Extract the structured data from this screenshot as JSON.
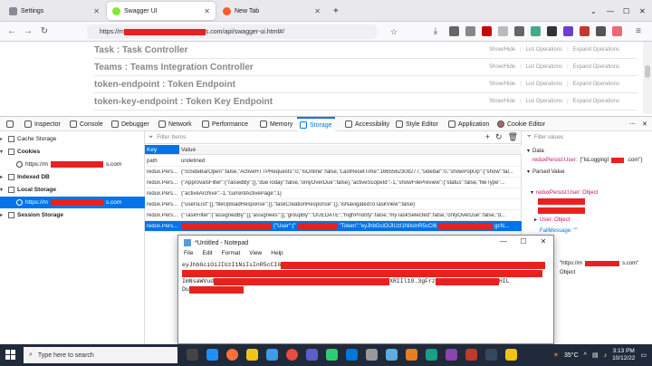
{
  "browser": {
    "tabs": [
      {
        "label": "Settings",
        "active": false
      },
      {
        "label": "Swagger UI",
        "active": true
      },
      {
        "label": "New Tab",
        "active": false
      }
    ],
    "url_prefix": "https://m",
    "url_suffix": "s.com/api/swagger-ui.html#/"
  },
  "swagger": {
    "rows": [
      {
        "title": "Task : Task Controller"
      },
      {
        "title": "Teams : Teams Integration Controller"
      },
      {
        "title": "token-endpoint : Token Endpoint"
      },
      {
        "title": "token-key-endpoint : Token Key Endpoint"
      }
    ],
    "links": {
      "show_hide": "Show/Hide",
      "list_ops": "List Operations",
      "expand_ops": "Expand Operations"
    }
  },
  "devtools": {
    "tabs": [
      "Inspector",
      "Console",
      "Debugger",
      "Network",
      "Performance",
      "Memory",
      "Storage",
      "Accessibility",
      "Style Editor",
      "Application",
      "Cookie Editor"
    ],
    "active_tab": "Storage",
    "sidebar": {
      "cache_storage": "Cache Storage",
      "cookies": "Cookies",
      "cookie_host_prefix": "https://m",
      "cookie_host_suffix": "s.com",
      "indexed_db": "Indexed DB",
      "local_storage": "Local Storage",
      "local_host_prefix": "https://m",
      "local_host_suffix": "s.com",
      "session_storage": "Session Storage"
    },
    "table": {
      "filter_placeholder": "Filter Items",
      "headers": {
        "key": "Key",
        "value": "Value"
      },
      "rows": [
        {
          "key": "path",
          "value": "undefined"
        },
        {
          "key": "redux.Pers...",
          "value": "{\"IsSideBarOpen\":false,\"ActiveHTTPRequests\":0,\"IsOnline\":false,\"LastResetTime\":1665562308277,\"sidebar\":0,\"showPopUp\":{\"show\":fal..."
        },
        {
          "key": "redux.Pers...",
          "value": "{\"ApprovalsFilter\":{\"raisedBy\":[],\"dueToday\":false,\"onlyOverDue\":false},\"activeScopeId\":-1,\"showFilePreview\":{\"status\":false,\"fileType\"..."
        },
        {
          "key": "redux.Pers...",
          "value": "{\"activeArchive\":-1,\"currentActivePage\":1}"
        },
        {
          "key": "redux.Pers...",
          "value": "{\"usersList\":[],\"fileUploadResponse\":{},\"taskCreationResponse\":{},\"isNavigatedToTaskView\":false}"
        },
        {
          "key": "redux.Pers...",
          "value": "{\"TaskFilter\":{\"assignedBy\":[],\"assignees\":[],\"groupBy\":\"DUEDATE\",\"highPriority\":false,\"myTaskSelected\":false,\"onlyOverDue\":false,\"d..."
        },
        {
          "key": "redux.Pers...",
          "value": "{\"User\":{\"",
          "value2": "\"Token\":\"eyJhbGciOiJIUzI1NiIsInR5cCI6",
          "value3": "gcN..."
        }
      ]
    },
    "right": {
      "filter_placeholder": "Filter values",
      "data_label": "Data",
      "data_key": "reduxPersist:User:",
      "data_val": "{\"IsLoggingI",
      "data_val_tail": ".com\"}",
      "parsed_label": "Parsed Value",
      "obj_key": "reduxPersist:User: Object",
      "user_obj": "User: Object",
      "fail_msg": "FailMessage: \"\"",
      "https_text": "\"https://m",
      "https_tail": "s.com\"",
      "object_text": "Object"
    }
  },
  "notepad": {
    "title": "*Untitled - Notepad",
    "menu": [
      "File",
      "Edit",
      "Format",
      "View",
      "Help"
    ],
    "line1": "eyJhbGciOiJIUzI1NiIsInR5cCI6",
    "line3a": "ImNsaWVud",
    "line3b": "XRIIl19.3gFrz",
    "line3c": "HIL",
    "line4a": "Du"
  },
  "taskbar": {
    "search_placeholder": "Type here to search",
    "temperature": "35°C",
    "time": "3:13 PM",
    "date": "10/12/22"
  },
  "colors": {
    "accent": "#0074e8",
    "redaction": "#e8211f",
    "taskbar": "#202a3a"
  }
}
